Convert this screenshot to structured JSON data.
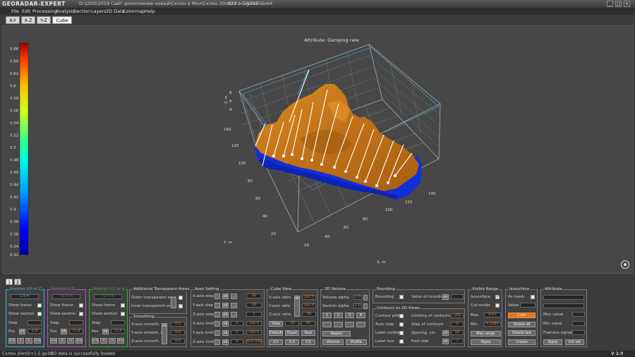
{
  "titlebar": {
    "logo": "GEORADAR-EXPERT",
    "path": "D:\\UOO\\2019 Сайт дополнение новый\\Склон в Мол\\Склон 20x02+1.5.ge3d",
    "xyz": "XYZ = 253x256x64"
  },
  "menu": [
    "File",
    "Edit",
    "Processing",
    "Analysis",
    "Section",
    "Layers",
    "3D Data",
    "Colormap",
    "Help"
  ],
  "tabs": [
    "X-Y",
    "X-Z",
    "Y-Z",
    "Cube"
  ],
  "plot": {
    "title": "Attribute: Damping rate",
    "colorbar_ticks": [
      "0.66",
      "0.64",
      "0.62",
      "0.6",
      "0.58",
      "0.56",
      "0.54",
      "0.52",
      "0.5",
      "0.48",
      "0.46",
      "0.44",
      "0.42",
      "0.4",
      "0.38",
      "0.36",
      "0.34",
      "0.32"
    ],
    "y_ticks": [
      "140",
      "120",
      "100",
      "80",
      "60",
      "40",
      "20"
    ],
    "x_ticks": [
      "20",
      "40",
      "60",
      "80",
      "100",
      "120",
      "140"
    ],
    "z_ticks": [
      "8",
      "6",
      "4"
    ],
    "ylabel": "Y, m",
    "xlabel": "X, m",
    "zlabel": "Z, m",
    "colors": {
      "surface": "#c87818",
      "base": "#1434d8",
      "frame": "#c8c8c8"
    }
  },
  "bottom_tabs": [
    "1",
    "2"
  ],
  "pos_x": {
    "title": "Position X-Y or Z",
    "value": "2.9 m",
    "show_frame": "Show frame",
    "show_section": "Show section",
    "step": "Step",
    "pos": "Pos",
    "pos_val": "2.9",
    "color": "#3ab0d8"
  },
  "pos_y": {
    "title": "Position X-Z",
    "value": "71.9 m",
    "show_frame": "Show frame",
    "show_section": "Show section",
    "step": "Step",
    "pos": "Pos",
    "pos_val": "71.9",
    "color": "#b050c0"
  },
  "pos_z": {
    "title": "Position Y-Z or X",
    "value": "72.5 m",
    "show_frame": "Show frame",
    "show_section": "Show section",
    "step": "Step",
    "pos": "Pos",
    "pos_val": "72.5",
    "color": "#30b030"
  },
  "nav_buttons": [
    "<<",
    "<",
    ">",
    ">>"
  ],
  "transparent": {
    "title": "Additional Transparent Areas",
    "outer": "Outer transparent area",
    "inner": "Inner transparent area"
  },
  "smoothing": {
    "title": "Smoothing",
    "x": "X-axis smooth, m",
    "y": "Y-axis smooth, m",
    "z": "Z-axis smooth, m",
    "xv": "0.6",
    "yv": "0.6",
    "zv": "0.6",
    "ok": "ok"
  },
  "axes": {
    "title": "Axes Setting",
    "rows": [
      {
        "label": "X-axis step",
        "val": "20"
      },
      {
        "label": "Y-axis step",
        "val": "20"
      },
      {
        "label": "Z-axis step",
        "val": "1"
      },
      {
        "label": "X-axis limit",
        "a": "0",
        "b": "141.5"
      },
      {
        "label": "Y-axis limit",
        "a": "0",
        "b": "142.5"
      },
      {
        "label": "Z-axis limit",
        "a": "0",
        "b": "8.87339"
      }
    ],
    "ok": "ok",
    "dots": "..."
  },
  "cube": {
    "title": "Cube View",
    "rows": [
      {
        "label": "X-axis ratio",
        "val": "141.5"
      },
      {
        "label": "Y-axis ratio",
        "val": "142.5"
      },
      {
        "label": "Z-axis ratio",
        "val": "30"
      }
    ],
    "view": "View",
    "view_a": "-24",
    "view_b": "64",
    "default": "Default",
    "equal": "Equal",
    "real": "Real",
    "xy": "X-Y",
    "xz": "X-Z",
    "yz": "Y-Z"
  },
  "volume": {
    "title": "3D Volume",
    "alpha": "Volume alpha",
    "alpha_val": "1.0",
    "section_alpha": "Section alpha",
    "section_alpha_val": "1.0",
    "nums": [
      "1",
      "2",
      "3",
      "4"
    ],
    "region": "Region",
    "volume": "Volume",
    "profile": "Profile"
  },
  "rounding": {
    "title": "Rounding",
    "rounding": "Rounding",
    "value": "Value of rounding",
    "ok": "ok"
  },
  "contours": {
    "title": "Contours on 2D Views",
    "plot": "Contour plot",
    "auto": "Auto step",
    "visible": "Label visible",
    "box": "Label box",
    "limiting": "Limiting of contours",
    "limiting_v": "100",
    "step": "Step of contours",
    "step_v": "0",
    "spacing": "Spacing, cm",
    "spacing_v": "10",
    "font": "Font size",
    "font_v": "7"
  },
  "visible": {
    "title": "Visible Range",
    "max": "Max",
    "max_v": "0.67",
    "min": "Min",
    "min_v": "0.3185",
    "max_range": "Max range",
    "apply": "Apply"
  },
  "isosurface": {
    "title": "Isosurface",
    "iso": "Isosurface",
    "as_mesh": "As mesh",
    "cut": "Cut inside",
    "value": "Value",
    "color": "Color",
    "delete_all": "Delete all",
    "delete_last": "Delete last",
    "create": "Create"
  },
  "attribute": {
    "title": "Attribute",
    "max": "Max value",
    "min": "Min value",
    "flatness": "Flatness signals",
    "apply": "Apply",
    "init": "Init set"
  },
  "status": {
    "file": "Склон 20x02+1.5.ge3d",
    "msg": "3D data is successfully loaded",
    "version": "V 2.0"
  }
}
